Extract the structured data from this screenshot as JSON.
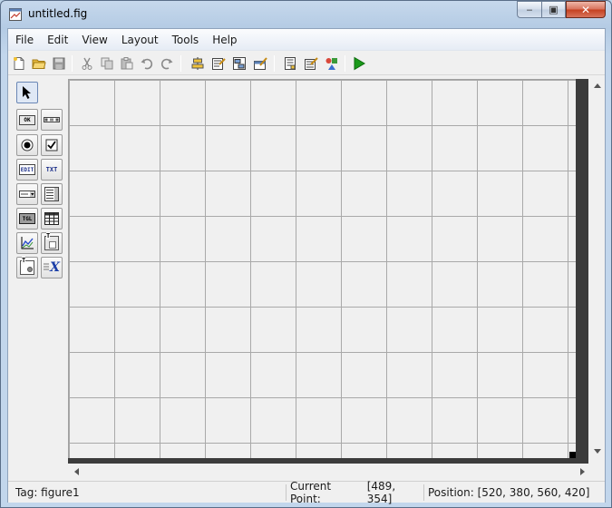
{
  "window": {
    "title": "untitled.fig",
    "min_glyph": "‒",
    "max_glyph": "▣",
    "close_glyph": "✕"
  },
  "menu": {
    "items": [
      "File",
      "Edit",
      "View",
      "Layout",
      "Tools",
      "Help"
    ]
  },
  "toolbar": {
    "buttons": [
      {
        "name": "new-file-icon"
      },
      {
        "name": "open-folder-icon"
      },
      {
        "name": "save-icon"
      },
      {
        "name": "cut-icon"
      },
      {
        "name": "copy-icon"
      },
      {
        "name": "paste-icon"
      },
      {
        "name": "undo-icon"
      },
      {
        "name": "redo-icon"
      },
      {
        "name": "align-objects-icon"
      },
      {
        "name": "menu-editor-icon"
      },
      {
        "name": "tab-order-editor-icon"
      },
      {
        "name": "toolbar-editor-icon"
      },
      {
        "name": "m-file-editor-icon"
      },
      {
        "name": "property-inspector-icon"
      },
      {
        "name": "object-browser-icon"
      },
      {
        "name": "run-figure-icon"
      }
    ],
    "colors": {
      "run": "#1a9a1a",
      "folder": "#e6b83c"
    }
  },
  "palette": {
    "tools": [
      {
        "name": "select-tool",
        "label": ""
      },
      {
        "name": "push-button-tool",
        "label": "OK"
      },
      {
        "name": "slider-tool",
        "label": ""
      },
      {
        "name": "radio-button-tool",
        "label": ""
      },
      {
        "name": "check-box-tool",
        "label": ""
      },
      {
        "name": "edit-text-tool",
        "label": "EDIT"
      },
      {
        "name": "static-text-tool",
        "label": "TXT"
      },
      {
        "name": "popup-menu-tool",
        "label": ""
      },
      {
        "name": "listbox-tool",
        "label": ""
      },
      {
        "name": "toggle-button-tool",
        "label": "TGL"
      },
      {
        "name": "table-tool",
        "label": ""
      },
      {
        "name": "axes-tool",
        "label": ""
      },
      {
        "name": "panel-tool",
        "label": "T"
      },
      {
        "name": "button-group-tool",
        "label": "T"
      },
      {
        "name": "activex-control-tool",
        "label": "X"
      }
    ]
  },
  "status": {
    "tag": "Tag: figure1",
    "current_point_label": "Current Point:",
    "current_point_value": "[489, 354]",
    "position": "Position: [520, 380, 560, 420]"
  }
}
